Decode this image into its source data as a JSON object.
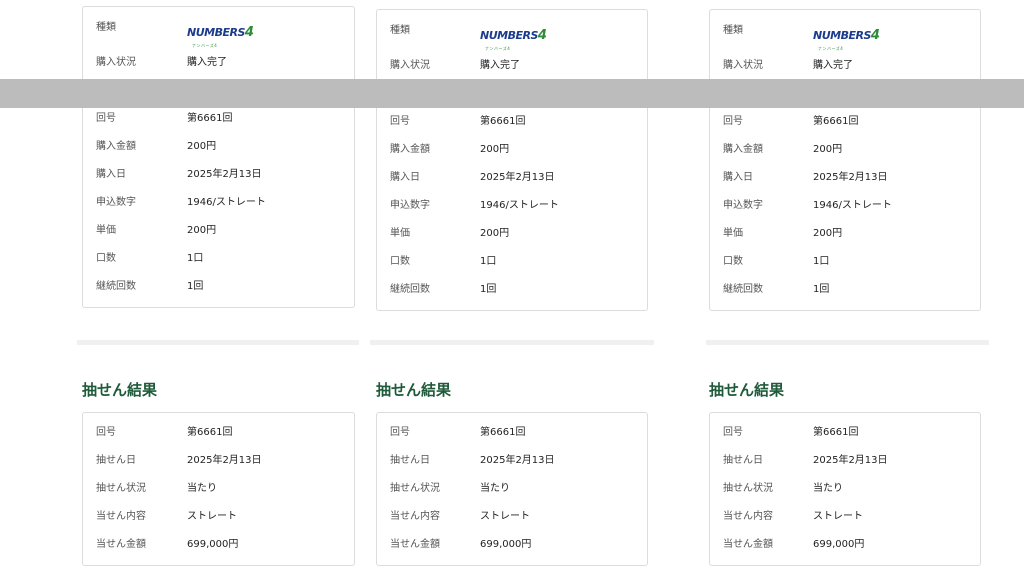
{
  "purchase_labels": {
    "type": "種類",
    "status": "購入状況",
    "round": "回号",
    "amount": "購入金額",
    "date": "購入日",
    "numbers": "申込数字",
    "unit_price": "単価",
    "units": "口数",
    "continuation": "継続回数"
  },
  "result_labels": {
    "heading": "抽せん結果",
    "round": "回号",
    "draw_date": "抽せん日",
    "draw_status": "抽せん状況",
    "win_detail": "当せん内容",
    "win_amount": "当せん金額"
  },
  "logo": {
    "text": "NUMBERS",
    "num": "4",
    "sub": "ナンバーズ4"
  },
  "colors": {
    "heading": "#1f5a3a",
    "logo_blue": "#1d3b8c",
    "logo_green": "#2e8b3a",
    "overlay_band": "#bcbcbc"
  },
  "cards": [
    {
      "purchase": {
        "status": "購入完了",
        "round": "第6661回",
        "amount": "200円",
        "date": "2025年2月13日",
        "numbers": "1946/ストレート",
        "unit_price": "200円",
        "units": "1口",
        "continuation": "1回"
      },
      "result": {
        "round": "第6661回",
        "draw_date": "2025年2月13日",
        "draw_status": "当たり",
        "win_detail": "ストレート",
        "win_amount": "699,000円"
      }
    },
    {
      "purchase": {
        "status": "購入完了",
        "round": "第6661回",
        "amount": "200円",
        "date": "2025年2月13日",
        "numbers": "1946/ストレート",
        "unit_price": "200円",
        "units": "1口",
        "continuation": "1回"
      },
      "result": {
        "round": "第6661回",
        "draw_date": "2025年2月13日",
        "draw_status": "当たり",
        "win_detail": "ストレート",
        "win_amount": "699,000円"
      }
    },
    {
      "purchase": {
        "status": "購入完了",
        "round": "第6661回",
        "amount": "200円",
        "date": "2025年2月13日",
        "numbers": "1946/ストレート",
        "unit_price": "200円",
        "units": "1口",
        "continuation": "1回"
      },
      "result": {
        "round": "第6661回",
        "draw_date": "2025年2月13日",
        "draw_status": "当たり",
        "win_detail": "ストレート",
        "win_amount": "699,000円"
      }
    }
  ]
}
